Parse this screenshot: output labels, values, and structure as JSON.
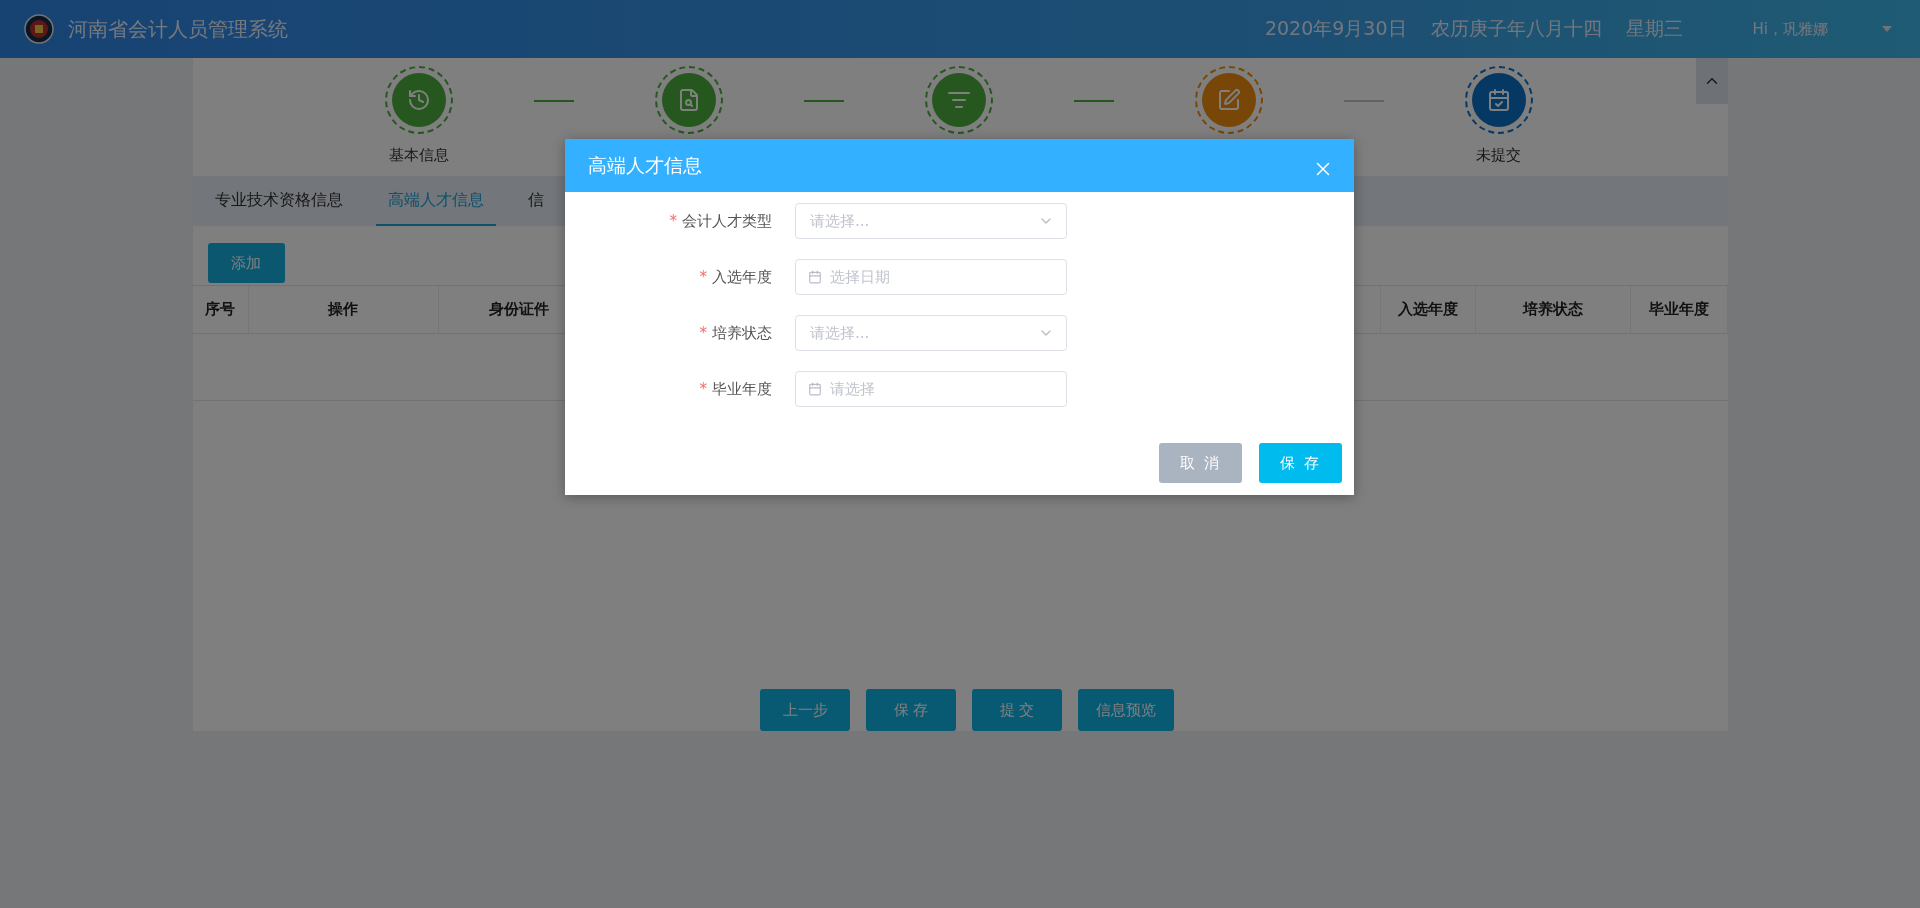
{
  "header": {
    "title": "河南省会计人员管理系统",
    "date": "2020年9月30日",
    "lunar_date": "农历庚子年八月十四",
    "weekday": "星期三",
    "user": "Hi，巩雅娜"
  },
  "steps": [
    {
      "label": "基本信息",
      "kind": "done"
    },
    {
      "kind": "done"
    },
    {
      "kind": "done"
    },
    {
      "kind": "current"
    },
    {
      "label": "未提交",
      "kind": "pending"
    }
  ],
  "tabs": [
    {
      "label": "专业技术资格信息",
      "selected": false
    },
    {
      "label": "高端人才信息",
      "selected": true
    },
    {
      "label": "信",
      "selected": false
    }
  ],
  "add_button": "添加",
  "table": {
    "columns": [
      "序号",
      "操作",
      "身份证件",
      "入选年度",
      "培养状态",
      "毕业年度"
    ]
  },
  "footer_buttons": [
    "上一步",
    "保 存",
    "提 交",
    "信息预览"
  ],
  "dialog": {
    "title": "高端人才信息",
    "fields": [
      {
        "required_mark": "*",
        "label": "会计人才类型",
        "kind": "select",
        "placeholder": "请选择..."
      },
      {
        "required_mark": "*",
        "label": "入选年度",
        "kind": "date",
        "placeholder": "选择日期"
      },
      {
        "required_mark": "*",
        "label": "培养状态",
        "kind": "select",
        "placeholder": "请选择..."
      },
      {
        "required_mark": "*",
        "label": "毕业年度",
        "kind": "date",
        "placeholder": "请选择"
      }
    ],
    "buttons": [
      {
        "label": "取 消",
        "kind": "secondary"
      },
      {
        "label": "保 存",
        "kind": "primary"
      }
    ]
  }
}
